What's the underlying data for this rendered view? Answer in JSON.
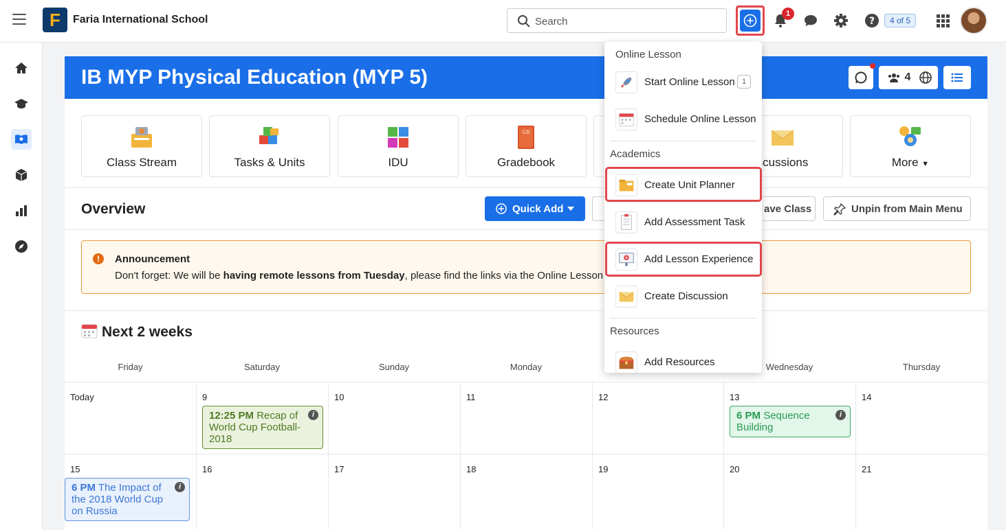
{
  "app": {
    "school_name": "Faria International School",
    "logo_letter": "F",
    "search_placeholder": "Search",
    "notification_count": "1",
    "pager": "4 of 5"
  },
  "course": {
    "title": "IB MYP Physical Education (MYP 5)",
    "member_count": "4"
  },
  "tiles": [
    {
      "label": "Class Stream"
    },
    {
      "label": "Tasks & Units"
    },
    {
      "label": "IDU"
    },
    {
      "label": "Gradebook"
    },
    {
      "label": ""
    },
    {
      "label": "scussions"
    },
    {
      "label": "More"
    }
  ],
  "overview": {
    "title": "Overview",
    "quick_add": "Quick Add",
    "leave_class": "ave Class",
    "unpin": "Unpin from Main Menu"
  },
  "announcement": {
    "title": "Announcement",
    "text_before": "Don't forget: We will be ",
    "text_bold": "having remote lessons from Tuesday",
    "text_after": ", please find the links via the Online Lesson sch"
  },
  "next_weeks": {
    "title": "Next 2 weeks"
  },
  "calendar": {
    "days": [
      "Friday",
      "Saturday",
      "Sunday",
      "Monday",
      "",
      "Wednesday",
      "Thursday"
    ],
    "row1": [
      "Today",
      "9",
      "10",
      "11",
      "12",
      "13",
      "14"
    ],
    "row2": [
      "15",
      "16",
      "17",
      "18",
      "19",
      "20",
      "21"
    ],
    "events": {
      "sat9": {
        "time": "12:25 PM",
        "title": "Recap of World Cup Football-2018"
      },
      "wed13": {
        "time": "6 PM",
        "title": "Sequence Building"
      },
      "fri15": {
        "time": "6 PM",
        "title": "The Impact of the 2018 World Cup on Russia"
      }
    }
  },
  "dropdown": {
    "online_header": "Online Lesson",
    "start_online": "Start Online Lesson",
    "start_online_count": "1",
    "schedule_online": "Schedule Online Lesson",
    "academics_header": "Academics",
    "create_unit": "Create Unit Planner",
    "add_assessment": "Add Assessment Task",
    "add_lesson": "Add Lesson Experience",
    "create_discussion": "Create Discussion",
    "resources_header": "Resources",
    "add_resources": "Add Resources"
  },
  "colors": {
    "brand_blue": "#1a6fe8",
    "highlight_red": "#e0474c",
    "announce_border": "#e99b3a"
  }
}
